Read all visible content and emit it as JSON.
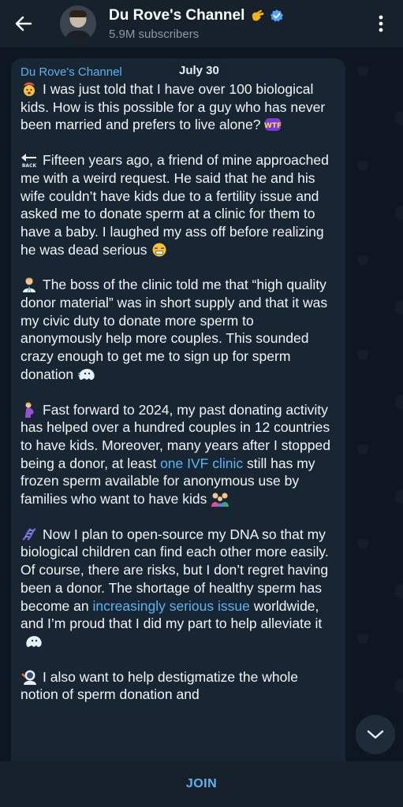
{
  "header": {
    "title": "Du Rove's Channel",
    "subscribers": "5.9M subscribers"
  },
  "chat": {
    "date": "July 30",
    "sender": "Du Rove's Channel",
    "paragraphs": [
      {
        "icon": "exploding-head-icon",
        "text": "I was just told that I have over 100 biological kids. How is this possible for a guy who has never been married and prefers to live alone?",
        "trailing_icon": "wtf-icon"
      },
      {
        "icon": "back-arrow-icon",
        "text": "Fifteen years ago, a friend of mine approached me with a weird request. He said that he and his wife couldn’t have kids due to a fertility issue and asked me to donate sperm at a clinic for them to have a baby. I laughed my ass off before realizing he was dead serious",
        "trailing_icon": "grimace-face-icon"
      },
      {
        "icon": "doctor-icon",
        "text": "The boss of the clinic told me that “high quality donor material” was in short supply and that it was my civic duty to donate more sperm to anonymously help more couples. This sounded crazy enough to get me to sign up for sperm donation",
        "trailing_icon": "ghost-icon"
      },
      {
        "icon": "pregnant-person-icon",
        "text_before": "Fast forward to 2024, my past donating activity has helped over a hundred couples in 12 countries to have kids. Moreover, many years after I stopped being a donor, at least ",
        "link": "one IVF clinic",
        "text_after": " still has my frozen sperm available for anonymous use by families who want to have kids",
        "trailing_icon": "family-icon"
      },
      {
        "icon": "dna-icon",
        "text_before": "Now I plan to open-source my DNA so that my biological children can find each other more easily. Of course, there are risks, but I don’t regret having been a donor. The shortage of healthy sperm has become an ",
        "link": "increasingly serious issue",
        "text_after": " worldwide, and I’m proud that I did my part to help alleviate it",
        "trailing_icon": "ghost-icon"
      },
      {
        "icon": "astronaut-icon",
        "text": "I also want to help destigmatize the whole notion of sperm donation and"
      }
    ]
  },
  "footer": {
    "join_label": "JOIN"
  },
  "colors": {
    "background": "#0e1621",
    "bubble": "#182533",
    "accent": "#5fb4f0",
    "header": "#17212b"
  }
}
